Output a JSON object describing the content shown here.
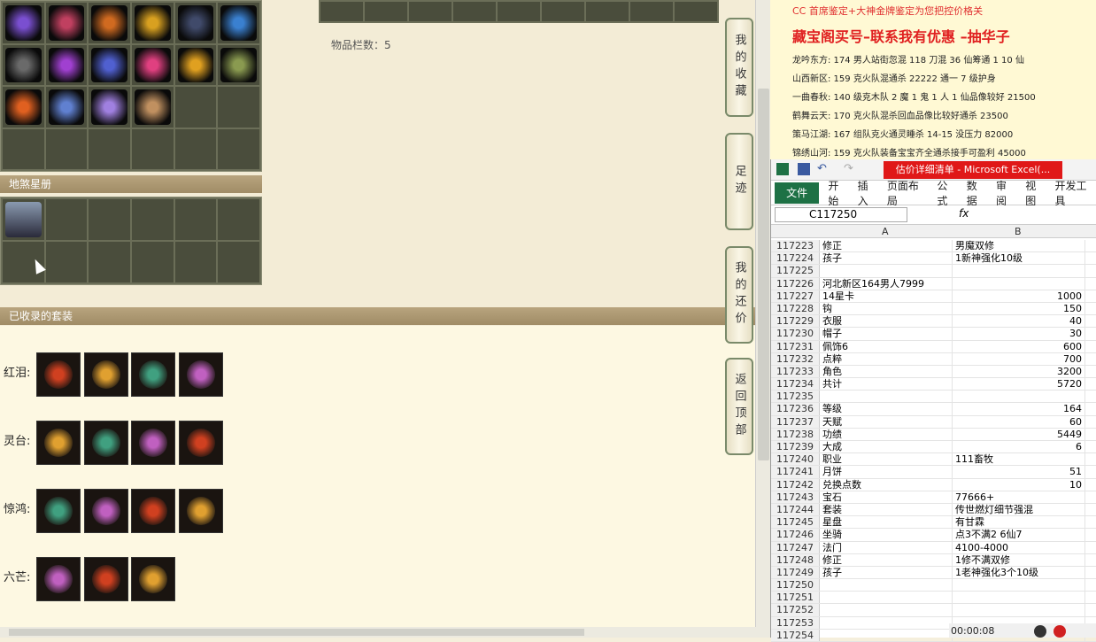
{
  "left_panel": {
    "slot_count": "物品栏数：5",
    "section_dishasha": "地煞星册",
    "section_suits": "已收录的套装",
    "suits": [
      {
        "label": "红泪:",
        "count": 4
      },
      {
        "label": "灵台:",
        "count": 4
      },
      {
        "label": "惊鸿:",
        "count": 4
      },
      {
        "label": "六芒:",
        "count": 3
      }
    ],
    "item_colors": [
      "#7a4fd0",
      "#c04060",
      "#d06a20",
      "#d8a020",
      "#404a6a",
      "#3a80d0",
      "#6a6a6a",
      "#a040d0",
      "#5060d0",
      "#e04080",
      "#e0a020",
      "#8a9a50",
      "#e06020",
      "#6080d0",
      "#a080e0",
      "#c09060"
    ]
  },
  "sidebar": {
    "tabs": [
      {
        "label": "我的收藏"
      },
      {
        "label": "足迹"
      },
      {
        "label": "我的还价"
      },
      {
        "label": "返回顶部"
      }
    ]
  },
  "doc": {
    "line1": "CC 首席鉴定+大神金牌鉴定为您把控价格关",
    "headline": "藏宝阁买号–联系我有优惠 –抽华子",
    "lines": [
      "龙吟东方: 174 男人站街忽混 118 刀混 36 仙筹通 1 10 仙",
      "山西新区: 159 克火队混通杀 22222 通一 7 级护身",
      "一曲春秋: 140 级克木队 2 魔 1 鬼 1 人 1 仙品像较好 21500",
      "鹤舞云天: 170 克火队混杀回血品像比较好通杀 23500",
      "策马江湖: 167 组队克火通灵睡杀 14-15 没压力 82000",
      "锦绣山河: 159 克火队装备宝宝齐全通杀接手可盈利 45000"
    ]
  },
  "excel": {
    "title": "估价详细清单 - Microsoft Excel(...",
    "tabs": [
      "文件",
      "开始",
      "插入",
      "页面布局",
      "公式",
      "数据",
      "审阅",
      "视图",
      "开发工具"
    ],
    "name_box": "C117250",
    "fx": "fx",
    "col_a": "A",
    "col_b": "B",
    "rows": [
      {
        "n": "117223",
        "a": "修正",
        "b": "男魔双修",
        "num": false
      },
      {
        "n": "117224",
        "a": "孩子",
        "b": "1新神强化10级",
        "num": false
      },
      {
        "n": "117225",
        "a": "",
        "b": "",
        "num": false
      },
      {
        "n": "117226",
        "a": "河北新区164男人7999",
        "b": "",
        "num": false
      },
      {
        "n": "117227",
        "a": "14星卡",
        "b": "1000",
        "num": true
      },
      {
        "n": "117228",
        "a": "钩",
        "b": "150",
        "num": true
      },
      {
        "n": "117229",
        "a": "衣服",
        "b": "40",
        "num": true
      },
      {
        "n": "117230",
        "a": "帽子",
        "b": "30",
        "num": true
      },
      {
        "n": "117231",
        "a": "佩饰6",
        "b": "600",
        "num": true
      },
      {
        "n": "117232",
        "a": "点粹",
        "b": "700",
        "num": true
      },
      {
        "n": "117233",
        "a": "角色",
        "b": "3200",
        "num": true
      },
      {
        "n": "117234",
        "a": "共计",
        "b": "5720",
        "num": true
      },
      {
        "n": "117235",
        "a": "",
        "b": "",
        "num": false
      },
      {
        "n": "117236",
        "a": "等级",
        "b": "164",
        "num": true
      },
      {
        "n": "117237",
        "a": "天赋",
        "b": "60",
        "num": true
      },
      {
        "n": "117238",
        "a": "功绩",
        "b": "5449",
        "num": true
      },
      {
        "n": "117239",
        "a": "大成",
        "b": "6",
        "num": true
      },
      {
        "n": "117240",
        "a": "职业",
        "b": "111畜牧",
        "num": false
      },
      {
        "n": "117241",
        "a": "月饼",
        "b": "51",
        "num": true
      },
      {
        "n": "117242",
        "a": "兑换点数",
        "b": "10",
        "num": true
      },
      {
        "n": "117243",
        "a": "宝石",
        "b": "77666+",
        "num": false
      },
      {
        "n": "117244",
        "a": "套装",
        "b": "传世燃灯细节强混",
        "num": false
      },
      {
        "n": "117245",
        "a": "星盘",
        "b": "有甘霖",
        "num": false
      },
      {
        "n": "117246",
        "a": "坐骑",
        "b": "点3不满2 6仙7",
        "num": false
      },
      {
        "n": "117247",
        "a": "法门",
        "b": "4100-4000",
        "num": false
      },
      {
        "n": "117248",
        "a": "修正",
        "b": "1修不满双修",
        "num": false
      },
      {
        "n": "117249",
        "a": "孩子",
        "b": "1老神强化3个10级",
        "num": false
      },
      {
        "n": "117250",
        "a": "",
        "b": "",
        "num": false
      },
      {
        "n": "117251",
        "a": "",
        "b": "",
        "num": false
      },
      {
        "n": "117252",
        "a": "",
        "b": "",
        "num": false
      },
      {
        "n": "117253",
        "a": "",
        "b": "",
        "num": false
      },
      {
        "n": "117254",
        "a": "",
        "b": "",
        "num": false
      }
    ]
  },
  "recorder": {
    "time": "00:00:08"
  }
}
